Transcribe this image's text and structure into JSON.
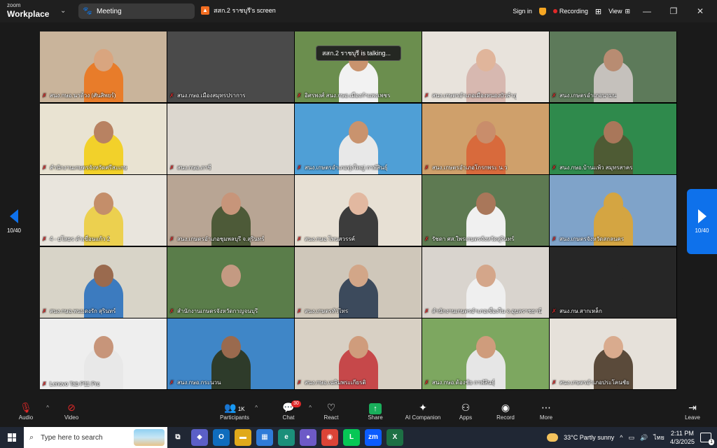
{
  "titlebar": {
    "logo_top": "zoom",
    "logo_bottom": "Workplace",
    "meeting_tab": "Meeting",
    "screen_tab": "สสก.2 ราชบุรี's screen",
    "sign_in": "Sign in",
    "recording": "Recording",
    "view": "View"
  },
  "stage": {
    "talking_banner": "สสก.2 ราชบุรี is talking...",
    "page_left": "10/40",
    "page_right": "10/40",
    "tiles": [
      {
        "name": "สนง.กษอ.นาด้วง (ศันสิพยร์)",
        "bg": "#c9b49b",
        "person": "#e87c2a",
        "skin": "#d9a57f"
      },
      {
        "name": "สนง.กษอ.เมืองสมุทรปราการ",
        "bg": "#4a4a4a",
        "person": "#4a4a4a",
        "skin": "#4a4a4a"
      },
      {
        "name": "อิศรพงศ์ สนง.กษอ.เมืองกำแพงเพชร",
        "bg": "#6b8e4e",
        "person": "#f2f2f2",
        "skin": "#c9936e"
      },
      {
        "name": "สนง.เกษตรอำเภอเมืองหนองบัวลำภู",
        "bg": "#e8e3dc",
        "person": "#d7b8b0",
        "skin": "#e0b59b"
      },
      {
        "name": "สนง.เกษตรอำเภอนามน",
        "bg": "#5d7a5a",
        "person": "#c5c1bc",
        "skin": "#b88c72"
      },
      {
        "name": "สำนักงานเกษตรจังหวัดศรีสะเกษ",
        "bg": "#e9e3d2",
        "person": "#f2d12a",
        "skin": "#b88262"
      },
      {
        "name": "สนง.กษอ.ภาชี",
        "bg": "#dcd7cf",
        "person": "#dcd7cf",
        "skin": "#dcd7cf"
      },
      {
        "name": "สนง.เกษตรอำเภอทุ่งใหญ่ กาฬสินธุ์",
        "bg": "#4f9fd6",
        "person": "#e8e8e8",
        "skin": "#c9936e"
      },
      {
        "name": "สนง.เกษตรอำเภอโกรกพระ น.ว",
        "bg": "#cfa06b",
        "person": "#d86a3c",
        "skin": "#c98d6b"
      },
      {
        "name": "สนง.กษอ.บ้านแพ้ว สมุทรสาคร",
        "bg": "#2f8a4c",
        "person": "#4e5b34",
        "skin": "#a9775a"
      },
      {
        "name": "4 - ยโสธร คำเขื่อนแก้ว 2",
        "bg": "#e9e5dd",
        "person": "#ecd04f",
        "skin": "#c48e6a"
      },
      {
        "name": "สนง.เกษตรอำเภอชุมพลบุรี จ.สุรินทร์",
        "bg": "#b8a594",
        "person": "#4d5a38",
        "skin": "#c7957a"
      },
      {
        "name": "สนง.กษอ.โพนสวรรค์",
        "bg": "#e7e0d4",
        "person": "#3c3c3c",
        "skin": "#e2b8a0"
      },
      {
        "name": "รัชดา ศส.ใพรเกษตรจังหวัดสุรินทร์",
        "bg": "#5e7a52",
        "person": "#f0f0f0",
        "skin": "#a9775a"
      },
      {
        "name": "สนง.เกษตรจังหวัดสกลนคร",
        "bg": "#7fa3c9",
        "person": "#d4a542",
        "skin": "#d4a542"
      },
      {
        "name": "สนง.กษอ.พนมดงรัก สุรินทร์",
        "bg": "#d8d4c8",
        "person": "#3c7bbf",
        "skin": "#9a6a4e"
      },
      {
        "name": "สำนักงานเกษตรจังหวัดกาญจนบุรี",
        "bg": "#5a7d4a",
        "person": "#5a7d4a",
        "skin": "#c49a82"
      },
      {
        "name": "สนง.เกษตรทัวไทร",
        "bg": "#cfc7ba",
        "person": "#3c4a5c",
        "skin": "#d2a688"
      },
      {
        "name": "สำนักงานเกษตรอำเภอเขื่องใน จ.อุบลราชธานี",
        "bg": "#d9d4ce",
        "person": "#efefef",
        "skin": "#d4a68a"
      },
      {
        "name": "สนง.กษ.สากเหล็ก",
        "bg": "#262626",
        "person": "#262626",
        "skin": "#262626"
      },
      {
        "name": "Lenovo Tab P11 Pro",
        "bg": "#eeeeee",
        "person": "#e8e8e8",
        "skin": "#c7957a"
      },
      {
        "name": "สนง.กษอ.กระนวน",
        "bg": "#3f86c7",
        "person": "#2e3b2a",
        "skin": "#9a6a4e"
      },
      {
        "name": "สนง.กษอ.เฉลิมพระเกียรติ",
        "bg": "#d8d0c4",
        "person": "#c6484a",
        "skin": "#cf9c7c"
      },
      {
        "name": "สนง.กษอ.ด้องชัย กาฬสินธุ์",
        "bg": "#7da760",
        "person": "#e6e6e6",
        "skin": "#cf9c7c"
      },
      {
        "name": "สนง.เกษตรอำเภอประโคนชัย",
        "bg": "#e6e1da",
        "person": "#5a4a3a",
        "skin": "#d9ab8e"
      }
    ]
  },
  "toolbar": {
    "audio": "Audio",
    "video": "Video",
    "participants": "Participants",
    "participants_count": "1K",
    "chat": "Chat",
    "chat_badge": "30",
    "react": "React",
    "share": "Share",
    "ai": "AI Companion",
    "apps": "Apps",
    "record": "Record",
    "more": "More",
    "leave": "Leave"
  },
  "taskbar": {
    "search_placeholder": "Type here to search",
    "weather": "33°C  Partly sunny",
    "lang": "ไทย",
    "time": "2:11 PM",
    "date": "4/3/2025",
    "notif_count": "1",
    "apps": [
      {
        "name": "task-view",
        "label": "⧉",
        "color": "#202734"
      },
      {
        "name": "copilot",
        "label": "◆",
        "color": "#5b5fc7"
      },
      {
        "name": "outlook",
        "label": "O",
        "color": "#0f6cbd"
      },
      {
        "name": "file-explorer",
        "label": "▬",
        "color": "#e0a91b"
      },
      {
        "name": "ms-store",
        "label": "▦",
        "color": "#2f7bd8"
      },
      {
        "name": "edge",
        "label": "e",
        "color": "#1b8f7a"
      },
      {
        "name": "chrome-alt",
        "label": "●",
        "color": "#6d5ac7"
      },
      {
        "name": "chrome",
        "label": "◉",
        "color": "#db4437"
      },
      {
        "name": "line",
        "label": "L",
        "color": "#06c755"
      },
      {
        "name": "zoom",
        "label": "zm",
        "color": "#0b5cff"
      },
      {
        "name": "excel",
        "label": "X",
        "color": "#1d7044"
      }
    ]
  }
}
